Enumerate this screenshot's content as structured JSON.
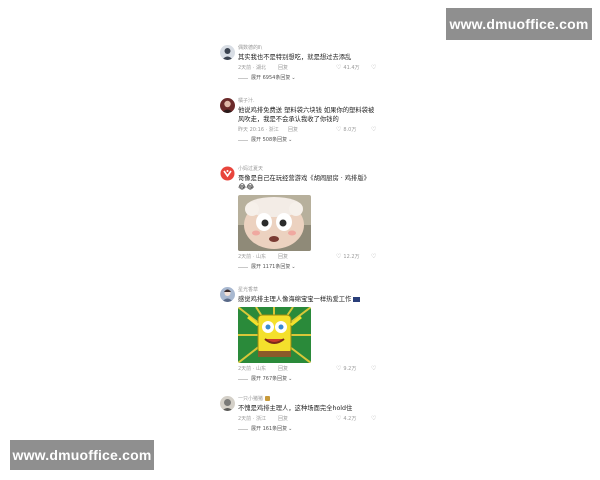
{
  "watermarks": {
    "top": "www.dmuoffice.com",
    "bottom": "www.dmuoffice.com"
  },
  "comments": [
    {
      "username": "偶数德的Ⅱ\\",
      "text": "其实我也不是特别想吃，就是想过去添乱",
      "time": "2天前 · 湖北",
      "reply": "回复",
      "likes": "41.4万",
      "expand": "展开 6954条回复"
    },
    {
      "username": "橘子汁.",
      "text": "他说鸡排免费送  塑料袋六块钱  如果你的塑料袋被风吹走，我是不会承认我收了你钱的",
      "time": "昨天 20:16 · 浙江",
      "reply": "回复",
      "likes": "8.0万",
      "expand": "展开 508条回复"
    },
    {
      "username": "小妈过夏天",
      "text": "哥像是自己在玩经营游戏《胡闹厨房 · 鸡排版》",
      "emoji": "😂😂",
      "time": "2天前 · 山东",
      "reply": "回复",
      "likes": "12.2万",
      "expand": "展开 1171条回复"
    },
    {
      "username": "星光香草",
      "text": "感觉鸡排主理人像海绵宝宝一样热爱工作",
      "time": "2天前 · 山东",
      "reply": "回复",
      "likes": "9.2万",
      "expand": "展开 767条回复"
    },
    {
      "username": "一只小猪猪",
      "text": "不愧是鸡排主理人，这种场面完全hold住",
      "time": "2天前 · 浙江",
      "reply": "回复",
      "likes": "4.2万",
      "expand": "展开 161条回复"
    }
  ],
  "icons": {
    "heart": "heart-icon",
    "dislike": "dislike-icon",
    "chevron": "chevron-down-icon"
  }
}
